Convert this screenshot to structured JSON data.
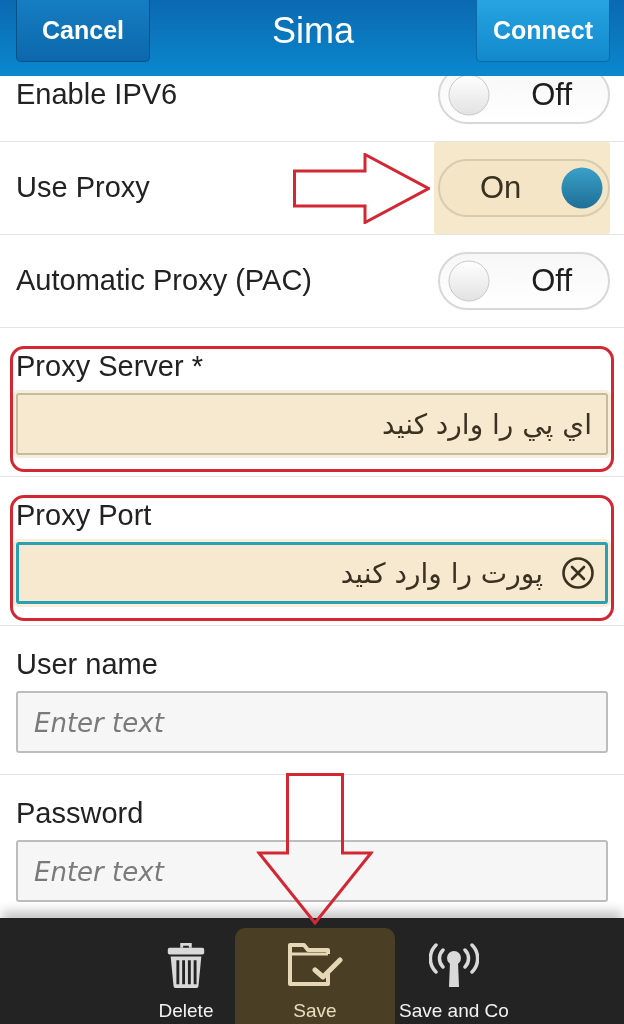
{
  "header": {
    "left_button": "Cancel",
    "title": "Sima",
    "right_button": "Connect"
  },
  "settings": [
    {
      "label": "Enable IPV6",
      "on": false,
      "state_label": "Off",
      "highlighted": false,
      "pointed_at": false
    },
    {
      "label": "Use Proxy",
      "on": true,
      "state_label": "On",
      "highlighted": true,
      "pointed_at": true
    },
    {
      "label": "Automatic Proxy (PAC)",
      "on": false,
      "state_label": "Off",
      "highlighted": false,
      "pointed_at": false
    }
  ],
  "fields": [
    {
      "label": "Proxy Server *",
      "value": "اي پي را وارد كنيد",
      "outlined": true,
      "highlighted": true,
      "focused": false
    },
    {
      "label": "Proxy Port",
      "value": "پورت را وارد كنيد",
      "outlined": true,
      "highlighted": true,
      "focused": true
    },
    {
      "label": "User name",
      "placeholder": "Enter text",
      "outlined": false,
      "highlighted": false,
      "focused": false
    },
    {
      "label": "Password",
      "placeholder": "Enter text",
      "outlined": false,
      "highlighted": false,
      "focused": false
    }
  ],
  "actions": [
    {
      "kind": "delete",
      "label": "Delete",
      "highlighted": false,
      "pointed_at": false
    },
    {
      "kind": "save",
      "label": "Save",
      "highlighted": true,
      "pointed_at": true
    },
    {
      "kind": "save_connect",
      "label": "Save and Co",
      "highlighted": false,
      "pointed_at": false
    }
  ]
}
